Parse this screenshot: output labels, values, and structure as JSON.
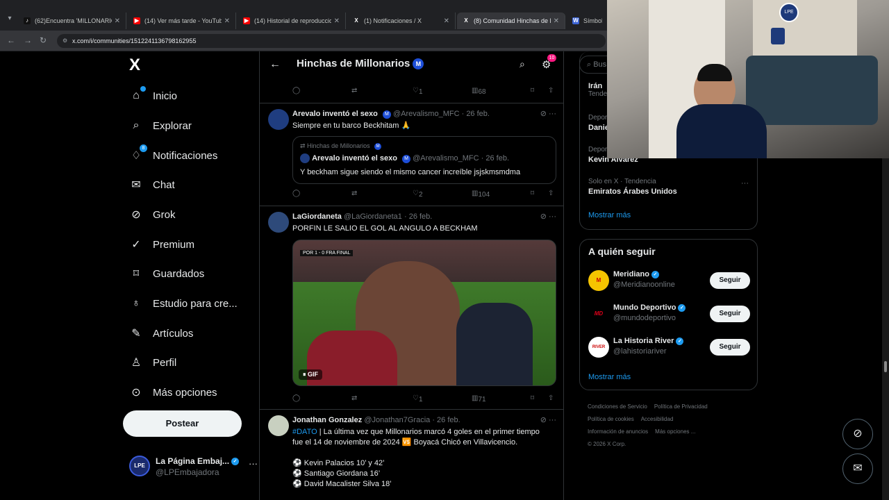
{
  "browser": {
    "tabs": [
      {
        "title": "(62)Encuentra 'MILLONARIOS' e",
        "icon": "tiktok-icon",
        "color": "#000000"
      },
      {
        "title": "(14) Ver más tarde - YouTube",
        "icon": "youtube-icon",
        "color": "#ff0000"
      },
      {
        "title": "(14) Historial de reproducciones",
        "icon": "youtube-icon",
        "color": "#ff0000"
      },
      {
        "title": "(1) Notificaciones / X",
        "icon": "x-icon",
        "color": "#000000"
      },
      {
        "title": "(8) Comunidad Hinchas de Millo",
        "icon": "x-icon",
        "color": "#000000",
        "active": true
      },
      {
        "title": "Símbolos",
        "icon": "w-icon",
        "color": "#3c64d4"
      }
    ],
    "url": "x.com/i/communities/1512241136798162955"
  },
  "sidebar": {
    "logo": "X",
    "items": [
      {
        "label": "Inicio",
        "icon": "home-icon"
      },
      {
        "label": "Explorar",
        "icon": "search-icon"
      },
      {
        "label": "Notificaciones",
        "icon": "bell-icon",
        "badge": "8"
      },
      {
        "label": "Chat",
        "icon": "mail-icon"
      },
      {
        "label": "Grok",
        "icon": "grok-icon"
      },
      {
        "label": "Premium",
        "icon": "premium-icon"
      },
      {
        "label": "Guardados",
        "icon": "bookmark-icon"
      },
      {
        "label": "Estudio para cre...",
        "icon": "studio-icon"
      },
      {
        "label": "Artículos",
        "icon": "article-icon"
      },
      {
        "label": "Perfil",
        "icon": "person-icon"
      },
      {
        "label": "Más opciones",
        "icon": "more-icon"
      }
    ],
    "post_label": "Postear",
    "account": {
      "name": "La Página Embaj...",
      "handle": "@LPEmbajadora",
      "avatar_text": "LPE"
    }
  },
  "community": {
    "title": "Hinchas de Millonarios",
    "badge": "M",
    "settings_count": "10"
  },
  "tweets": [
    {
      "stats": {
        "replies": "",
        "retweets": "",
        "likes": "1",
        "views": "68"
      }
    },
    {
      "author": "Arevalo inventó el sexo",
      "handle": "@Arevalismo_MFC",
      "date": "· 26 feb.",
      "text": "Siempre en tu barco Beckhitam 🙏",
      "quote": {
        "context": "Hinchas de Millonarios",
        "author": "Arevalo inventó el sexo",
        "handle": "@Arevalismo_MFC",
        "date": "· 26 feb.",
        "text": "Y beckham sigue siendo el mismo cancer increíble jsjskmsmdma"
      },
      "stats": {
        "likes": "2",
        "views": "104"
      }
    },
    {
      "author": "LaGiordaneta",
      "handle": "@LaGiordaneta1",
      "date": "· 26 feb.",
      "text": "PORFIN LE SALIO EL GOL AL ANGULO A BECKHAM",
      "media": {
        "score": "POR 1 - 0 FRA",
        "stage": "FINAL",
        "gif_label": "GIF"
      },
      "stats": {
        "likes": "1",
        "views": "71"
      }
    },
    {
      "author": "Jonathan Gonzalez",
      "handle": "@Jonathan7Gracia",
      "date": "· 26 feb.",
      "hashtag": "#DATO",
      "line1": " | La última vez que Millonarios marcó 4 goles en el primer tiempo",
      "line2": "fue el 14 de noviembre de 2024 🆚 Boyacá Chicó en Villavicencio.",
      "goals": [
        "⚽ Kevin Palacios 10’ y 42’",
        "⚽ Santiago Giordana 16’",
        "⚽ David Macalister Silva 18’"
      ]
    }
  ],
  "right": {
    "search_placeholder": "Bus",
    "trends": [
      {
        "context": "",
        "name": "Irán",
        "sub": "Tende"
      },
      {
        "context": "Depor",
        "name": "Danie"
      },
      {
        "context": "Depor",
        "name": "Kevin Alvarez"
      },
      {
        "context": "Solo en X · Tendencia",
        "name": "Emiratos Árabes Unidos"
      }
    ],
    "show_more": "Mostrar más",
    "who_to_follow": {
      "title": "A quién seguir",
      "accounts": [
        {
          "name": "Meridiano",
          "handle": "@Meridianoonline",
          "button": "Seguir",
          "avatar_text": "M",
          "color": "#f5c400"
        },
        {
          "name": "Mundo Deportivo",
          "handle": "@mundodeportivo",
          "button": "Seguir",
          "avatar_text": "MD",
          "color": "#ffffff"
        },
        {
          "name": "La Historia River",
          "handle": "@lahistoriariver",
          "button": "Seguir",
          "avatar_text": "RIVER",
          "color": "#ffffff"
        }
      ],
      "show_more": "Mostrar más"
    },
    "footer": [
      "Condiciones de Servicio",
      "Política de Privacidad",
      "Política de cookies",
      "Accesibilidad",
      "Información de anuncios",
      "Más opciones ...",
      "© 2026 X Corp."
    ]
  }
}
